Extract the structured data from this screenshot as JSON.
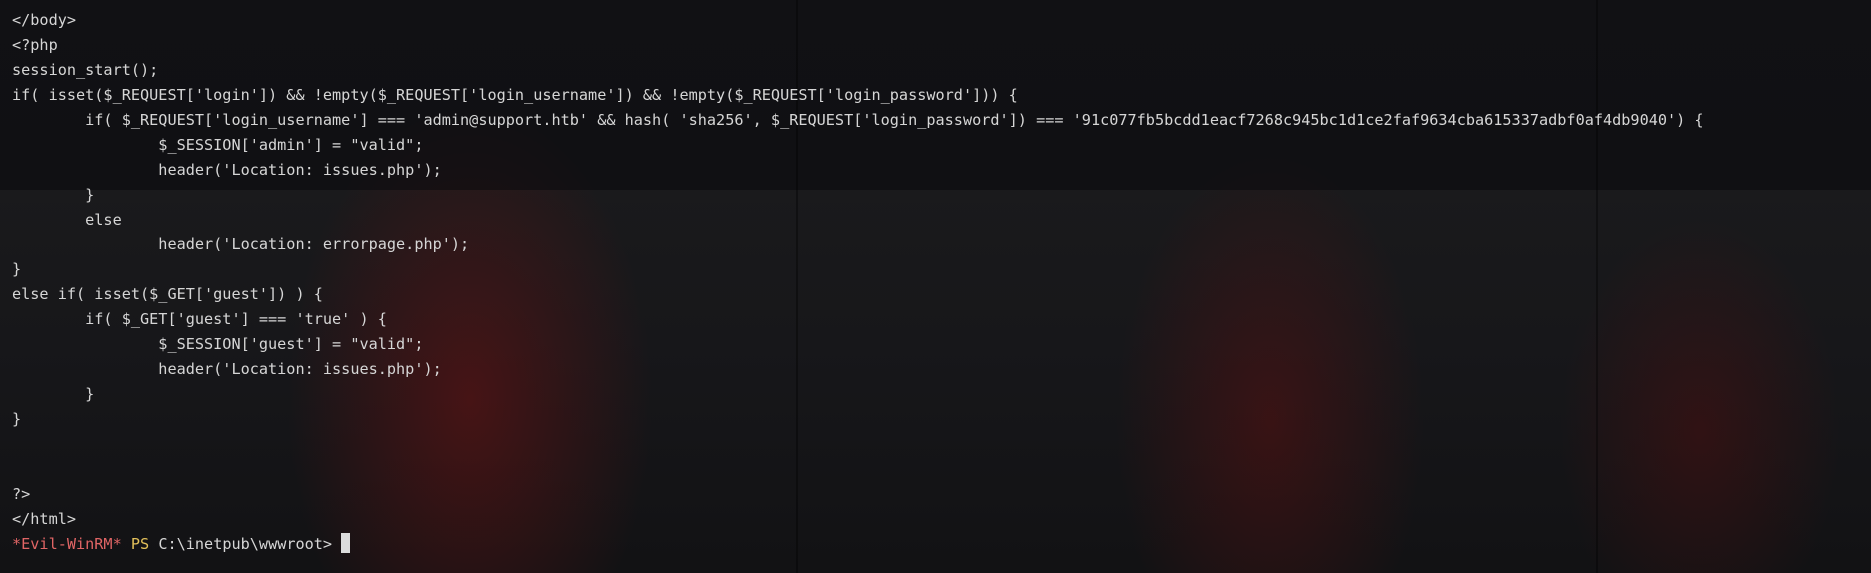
{
  "terminal": {
    "lines": [
      "</body>",
      "<?php",
      "session_start();",
      "if( isset($_REQUEST['login']) && !empty($_REQUEST['login_username']) && !empty($_REQUEST['login_password'])) {",
      "        if( $_REQUEST['login_username'] === 'admin@support.htb' && hash( 'sha256', $_REQUEST['login_password']) === '91c077fb5bcdd1eacf7268c945bc1d1ce2faf9634cba615337adbf0af4db9040') {",
      "                $_SESSION['admin'] = \"valid\";",
      "                header('Location: issues.php');",
      "        }",
      "        else",
      "                header('Location: errorpage.php');",
      "}",
      "else if( isset($_GET['guest']) ) {",
      "        if( $_GET['guest'] === 'true' ) {",
      "                $_SESSION['guest'] = \"valid\";",
      "                header('Location: issues.php');",
      "        }",
      "}",
      "",
      "",
      "?>",
      "</html>"
    ],
    "prompt": {
      "shell_name": "*Evil-WinRM*",
      "ps_label": "PS",
      "path": "C:\\inetpub\\wwwroot>"
    },
    "colors": {
      "text": "#d6d6d6",
      "shell_name": "#e06565",
      "ps_label": "#e3c15a"
    }
  }
}
